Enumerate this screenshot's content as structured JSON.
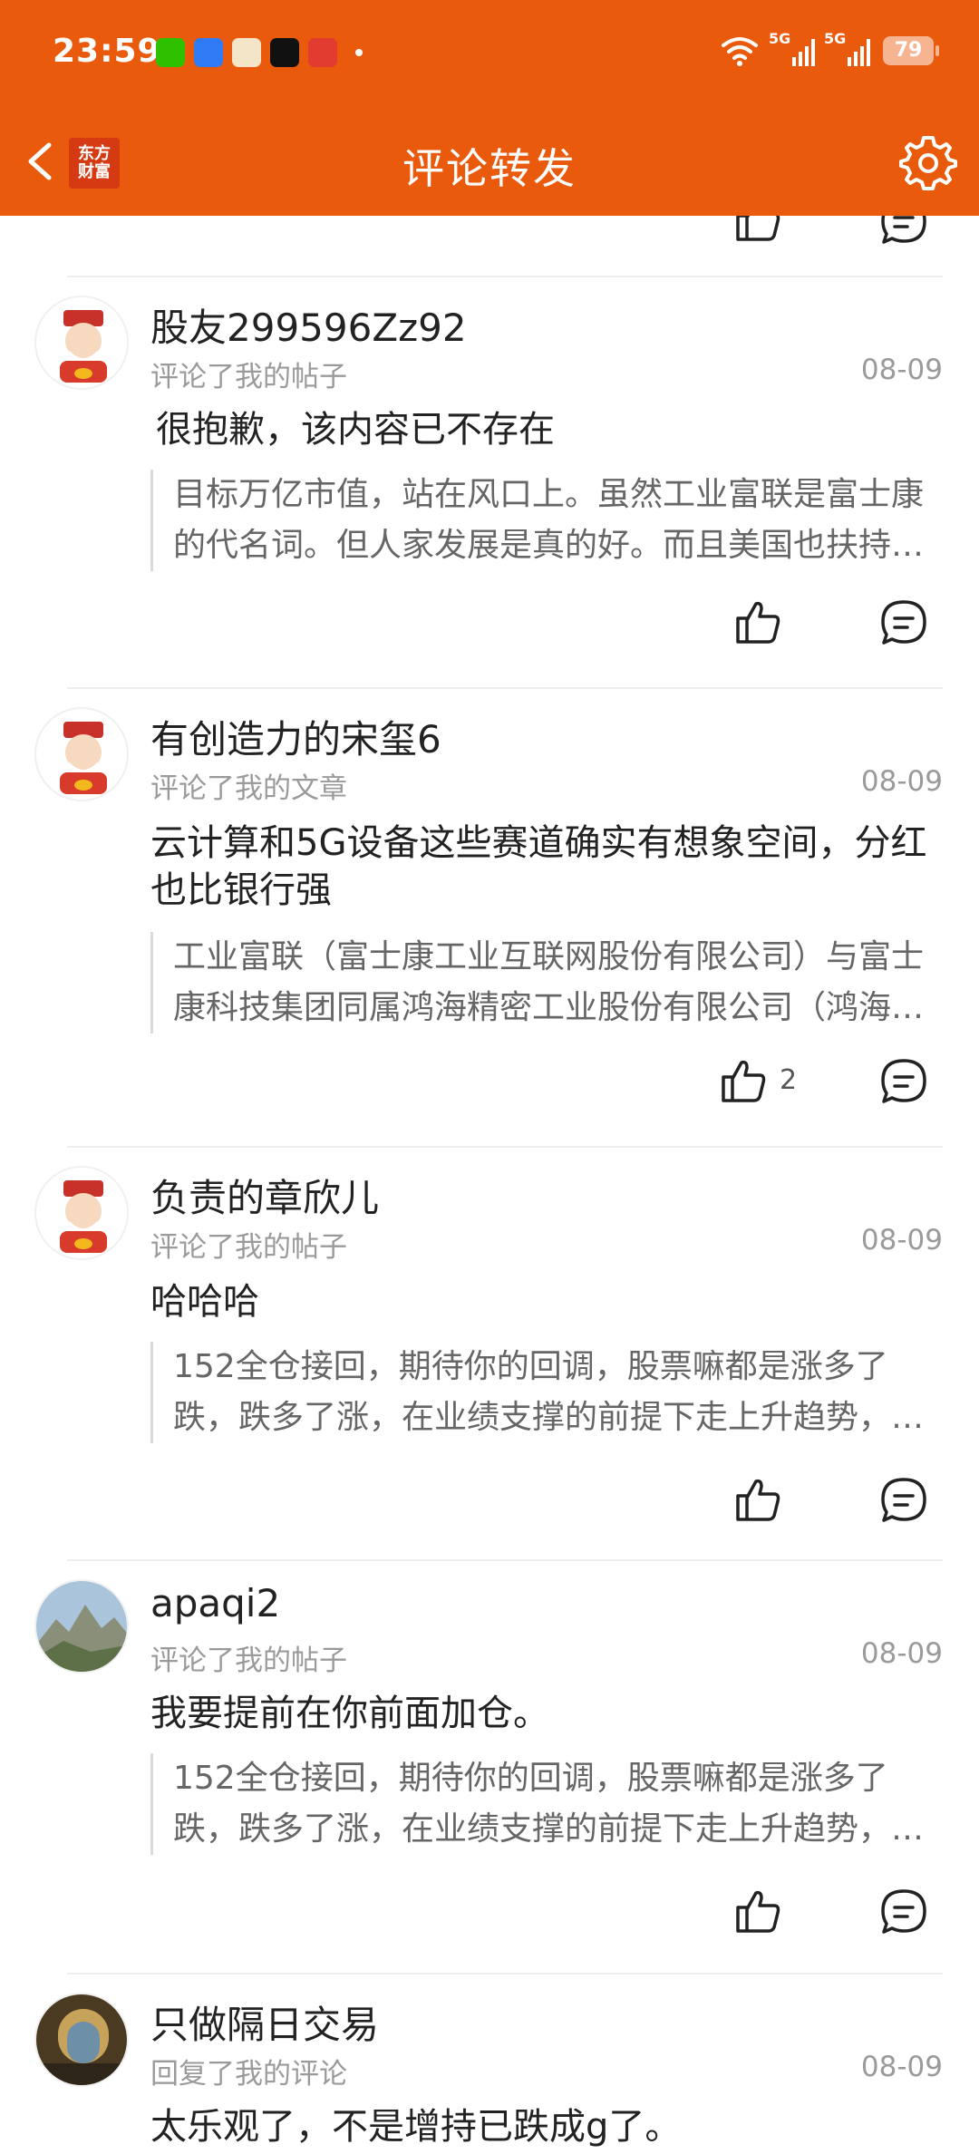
{
  "status_bar": {
    "time": "23:59",
    "battery": "79",
    "network_1": "5G",
    "network_2": "5G",
    "app_icons": [
      "wechat-icon",
      "nfc-icon",
      "cat-icon",
      "music-icon",
      "stock-icon"
    ]
  },
  "nav": {
    "title": "评论转发",
    "logo_line1": "东方",
    "logo_line2": "财富"
  },
  "comments": [
    {
      "username": "股友299596Zz92",
      "action": "评论了我的帖子",
      "date": "08-09",
      "text": "很抱歉，该内容已不存在",
      "quote": "目标万亿市值，站在风口上。虽然工业富联是富士康的代名词。但人家发展是真的好。而且美国也扶持…",
      "likes": ""
    },
    {
      "username": "有创造力的宋玺6",
      "action": "评论了我的文章",
      "date": "08-09",
      "text": "云计算和5G设备这些赛道确实有想象空间，分红也比银行强",
      "quote": "工业富联（富士康工业互联网股份有限公司）与富士康科技集团同属鸿海精密工业股份有限公司（鸿海…",
      "likes": "2"
    },
    {
      "username": "负责的章欣儿",
      "action": "评论了我的帖子",
      "date": "08-09",
      "text": "哈哈哈",
      "quote": "152全仓接回，期待你的回调，股票嘛都是涨多了跌，跌多了涨，在业绩支撑的前提下走上升趋势，…",
      "likes": ""
    },
    {
      "username": "apaqi2",
      "action": "评论了我的帖子",
      "date": "08-09",
      "text": "我要提前在你前面加仓。",
      "quote": "152全仓接回，期待你的回调，股票嘛都是涨多了跌，跌多了涨，在业绩支撑的前提下走上升趋势，…",
      "likes": ""
    },
    {
      "username": "只做隔日交易",
      "action": "回复了我的评论",
      "date": "08-09",
      "text": "太乐观了，不是增持已跌成g了。",
      "quote": "",
      "likes": ""
    }
  ],
  "colors": {
    "brand": "#ea5a0c",
    "muted_text": "#9a9a9a"
  }
}
